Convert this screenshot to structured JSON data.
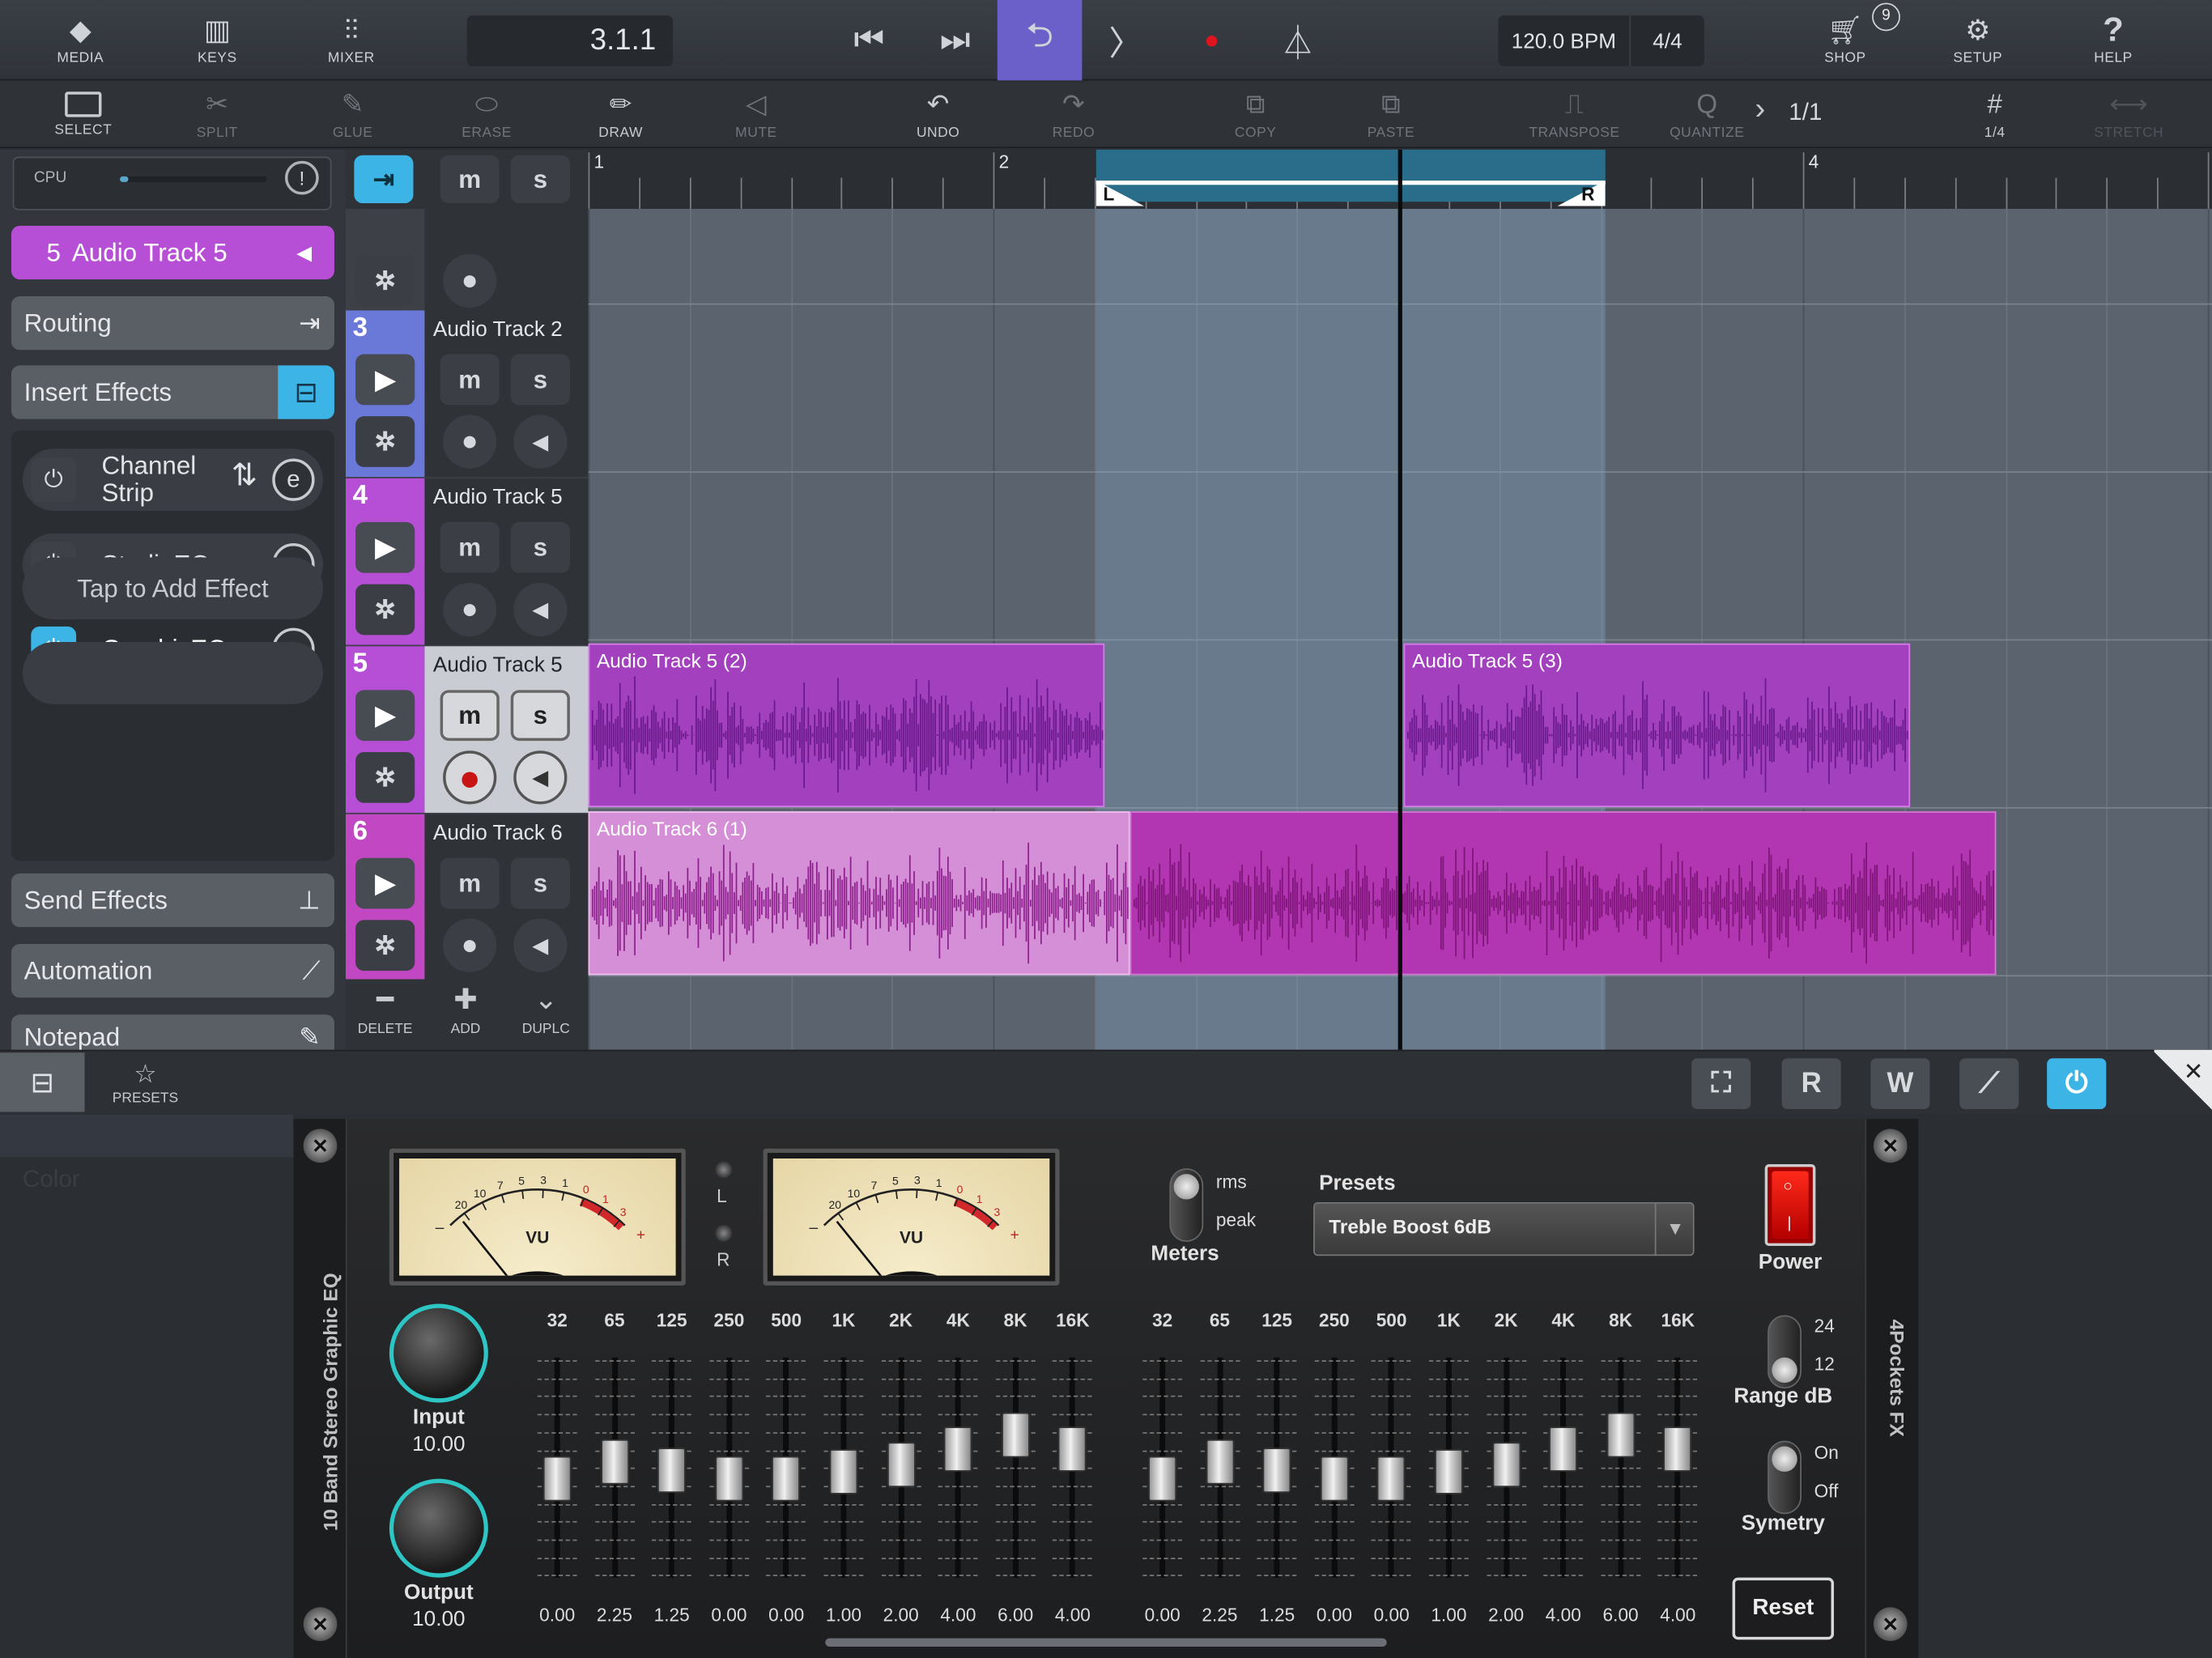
{
  "topbar": {
    "media": "MEDIA",
    "keys": "KEYS",
    "mixer": "MIXER",
    "position": "3.1.1",
    "tempo": "120.0 BPM",
    "signature": "4/4",
    "shop": "SHOP",
    "shop_badge": "9",
    "setup": "SETUP",
    "help": "HELP"
  },
  "toolbar": {
    "select": "SELECT",
    "split": "SPLIT",
    "glue": "GLUE",
    "erase": "ERASE",
    "draw": "DRAW",
    "mute": "MUTE",
    "undo": "UNDO",
    "redo": "REDO",
    "copy": "COPY",
    "paste": "PASTE",
    "transpose": "TRANSPOSE",
    "quantize": "QUANTIZE",
    "quantize_value": "1/1",
    "grid_value": "1/4",
    "stretch": "STRETCH"
  },
  "left": {
    "cpu": "CPU",
    "selected_num": "5",
    "selected_name": "Audio Track 5",
    "routing": "Routing",
    "insert_effects": "Insert Effects",
    "effects": [
      {
        "name_line1": "Channel",
        "name_line2": "Strip"
      },
      {
        "name": "StudioEQ"
      },
      {
        "name": "GraphicEQ"
      }
    ],
    "add_effect": "Tap to Add Effect",
    "send_effects": "Send Effects",
    "automation": "Automation",
    "notepad": "Notepad",
    "color": "Color"
  },
  "tracks": [
    {
      "num": "3",
      "name": "Audio Track 2",
      "color": "#6a78d8"
    },
    {
      "num": "4",
      "name": "Audio Track 5",
      "color": "#b64fd6"
    },
    {
      "num": "5",
      "name": "Audio Track 5",
      "color": "#b64fd6"
    },
    {
      "num": "6",
      "name": "Audio Track 6",
      "color": "#c247c2"
    }
  ],
  "track_footer": {
    "delete": "DELETE",
    "add": "ADD",
    "duplicate": "DUPLC"
  },
  "ruler": {
    "bars": [
      "1",
      "2",
      "3",
      "4"
    ],
    "loop_left": "L",
    "loop_right": "R"
  },
  "clips": {
    "c1": "Audio Track 5 (2)",
    "c2": "Audio Track 5 (3)",
    "c3": "Audio Track 6 (1)"
  },
  "plugin_bar": {
    "presets": "PRESETS",
    "btn_r": "R",
    "btn_w": "W"
  },
  "eq": {
    "vertical_title": "10 Band Stereo Graphic EQ",
    "brand": "4Pockets FX",
    "vu_label": "VU",
    "vu_scale": [
      "20",
      "10",
      "7",
      "5",
      "3",
      "1",
      "0",
      "1",
      "3"
    ],
    "vu_minus": "–",
    "vu_plus": "+",
    "led_l": "L",
    "led_r": "R",
    "input_label": "Input",
    "input_value": "10.00",
    "output_label": "Output",
    "output_value": "10.00",
    "meters": "Meters",
    "rms": "rms",
    "peak": "peak",
    "presets_label": "Presets",
    "preset_value": "Treble Boost 6dB",
    "power": "Power",
    "range_label": "Range dB",
    "range_24": "24",
    "range_12": "12",
    "symmetry": "Symetry",
    "on": "On",
    "off": "Off",
    "reset": "Reset",
    "bands": [
      "32",
      "65",
      "125",
      "250",
      "500",
      "1K",
      "2K",
      "4K",
      "8K",
      "16K"
    ],
    "left_values": [
      "0.00",
      "2.25",
      "1.25",
      "0.00",
      "0.00",
      "1.00",
      "2.00",
      "4.00",
      "6.00",
      "4.00"
    ],
    "right_values": [
      "0.00",
      "2.25",
      "1.25",
      "0.00",
      "0.00",
      "1.00",
      "2.00",
      "4.00",
      "6.00",
      "4.00"
    ],
    "range_db": 12
  }
}
